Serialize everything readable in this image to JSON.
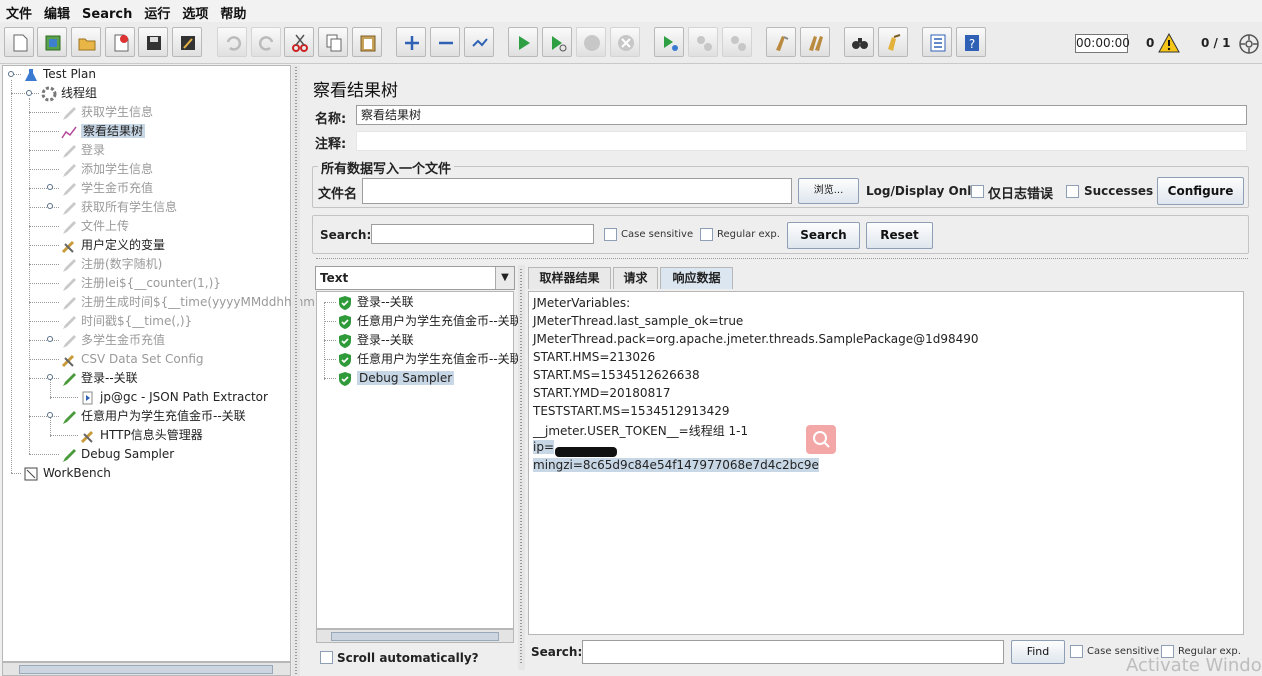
{
  "menu": [
    "文件",
    "编辑",
    "Search",
    "运行",
    "选项",
    "帮助"
  ],
  "toolbar": {
    "timer": "00:00:00",
    "error_count": "0",
    "threads": "0 / 1",
    "icons": [
      "new-icon",
      "templates-icon",
      "open-icon",
      "close-icon",
      "save-icon",
      "save-as-icon",
      "undo-icon",
      "redo-icon",
      "cut-icon",
      "copy-icon",
      "paste-icon",
      "expand-icon",
      "collapse-icon",
      "toggle-icon",
      "start-icon",
      "start-no-pause-icon",
      "stop-icon",
      "shutdown-icon",
      "remote-start-icon",
      "remote-stop-icon",
      "remote-shutdown-icon",
      "clear-icon",
      "clear-all-icon",
      "search-icon",
      "reset-search-icon",
      "function-helper-icon",
      "help-icon"
    ]
  },
  "tree": [
    {
      "label": "Test Plan",
      "level": 0,
      "icon": "test-plan-icon",
      "dim": false
    },
    {
      "label": "线程组",
      "level": 1,
      "icon": "thread-group-icon",
      "dim": false
    },
    {
      "label": "获取学生信息",
      "level": 2,
      "icon": "sampler-icon",
      "dim": true
    },
    {
      "label": "察看结果树",
      "level": 2,
      "icon": "listener-icon",
      "dim": false,
      "selected": true
    },
    {
      "label": "登录",
      "level": 2,
      "icon": "sampler-icon",
      "dim": true
    },
    {
      "label": "添加学生信息",
      "level": 2,
      "icon": "sampler-icon",
      "dim": true
    },
    {
      "label": "学生金币充值",
      "level": 2,
      "icon": "sampler-icon",
      "dim": true
    },
    {
      "label": "获取所有学生信息",
      "level": 2,
      "icon": "sampler-icon",
      "dim": true
    },
    {
      "label": "文件上传",
      "level": 2,
      "icon": "sampler-icon",
      "dim": true
    },
    {
      "label": "用户定义的变量",
      "level": 2,
      "icon": "config-icon",
      "dim": false
    },
    {
      "label": "注册(数字随机)",
      "level": 2,
      "icon": "sampler-icon",
      "dim": true
    },
    {
      "label": "注册lei${__counter(1,)}",
      "level": 2,
      "icon": "sampler-icon",
      "dim": true
    },
    {
      "label": "注册生成时间${__time(yyyyMMddhhmm",
      "level": 2,
      "icon": "sampler-icon",
      "dim": true
    },
    {
      "label": "时间戳${__time(,)}",
      "level": 2,
      "icon": "sampler-icon",
      "dim": true
    },
    {
      "label": "多学生金币充值",
      "level": 2,
      "icon": "sampler-icon",
      "dim": true
    },
    {
      "label": "CSV Data Set Config",
      "level": 2,
      "icon": "config-icon",
      "dim": true
    },
    {
      "label": "登录--关联",
      "level": 2,
      "icon": "sampler-icon",
      "dim": false
    },
    {
      "label": "jp@gc - JSON Path Extractor",
      "level": 3,
      "icon": "extractor-icon",
      "dim": false
    },
    {
      "label": "任意用户为学生充值金币--关联",
      "level": 2,
      "icon": "sampler-icon",
      "dim": false
    },
    {
      "label": "HTTP信息头管理器",
      "level": 3,
      "icon": "config-icon",
      "dim": false
    },
    {
      "label": "Debug Sampler",
      "level": 2,
      "icon": "sampler-icon",
      "dim": false
    },
    {
      "label": "WorkBench",
      "level": 0,
      "icon": "workbench-icon",
      "dim": false
    }
  ],
  "panel": {
    "title": "察看结果树",
    "name_label": "名称:",
    "name_value": "察看结果树",
    "comment_label": "注释:",
    "file_group_title": "所有数据写入一个文件",
    "filename_label": "文件名",
    "browse": "浏览...",
    "log_display": "Log/Display Only:",
    "errors_only": "仅日志错误",
    "successes": "Successes",
    "configure": "Configure",
    "search_label": "Search:",
    "case_sensitive": "Case sensitive",
    "regular_exp": "Regular exp.",
    "search_btn": "Search",
    "reset_btn": "Reset",
    "renderer": "Text",
    "scroll_auto": "Scroll automatically?",
    "tabs": [
      "取样器结果",
      "请求",
      "响应数据"
    ],
    "find_btn": "Find"
  },
  "results": [
    {
      "label": "登录--关联"
    },
    {
      "label": "任意用户为学生充值金币--关联"
    },
    {
      "label": "登录--关联"
    },
    {
      "label": "任意用户为学生充值金币--关联"
    },
    {
      "label": "Debug Sampler",
      "selected": true
    }
  ],
  "response": [
    "JMeterVariables:",
    "JMeterThread.last_sample_ok=true",
    "JMeterThread.pack=org.apache.jmeter.threads.SamplePackage@1d98490",
    "START.HMS=213026",
    "START.MS=1534512626638",
    "START.YMD=20180817",
    "TESTSTART.MS=1534512913429",
    "__jmeter.USER_TOKEN__=线程组 1-1",
    "ip=",
    "mingzi=8c65d9c84e54f147977068e7d4c2bc9e"
  ],
  "watermark": "Activate Windo"
}
